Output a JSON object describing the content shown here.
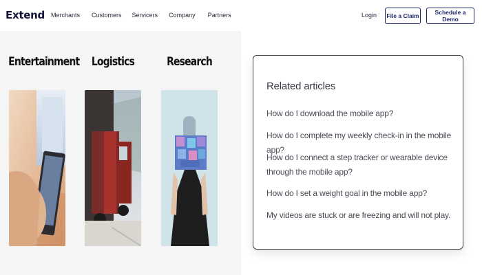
{
  "header": {
    "logo": "Extend",
    "nav": [
      "Merchants",
      "Customers",
      "Servicers",
      "Company",
      "Partners"
    ],
    "login": "Login",
    "claim_button": "File a Claim",
    "demo_button": "Schedule a Demo"
  },
  "categories": [
    {
      "title": "Entertainment"
    },
    {
      "title": "Logistics"
    },
    {
      "title": "Research"
    }
  ],
  "related": {
    "title": "Related articles",
    "articles": [
      "How do I download the mobile app?",
      "How do I complete my weekly check-in in the mobile app?",
      "How do I connect a step tracker or wearable device through the mobile app?",
      "How do I set a weight goal in the mobile app?",
      "My videos are stuck or are freezing and will not play."
    ]
  },
  "colors": {
    "brand_navy": "#1b2466",
    "left_background": "#f5f5f5"
  }
}
